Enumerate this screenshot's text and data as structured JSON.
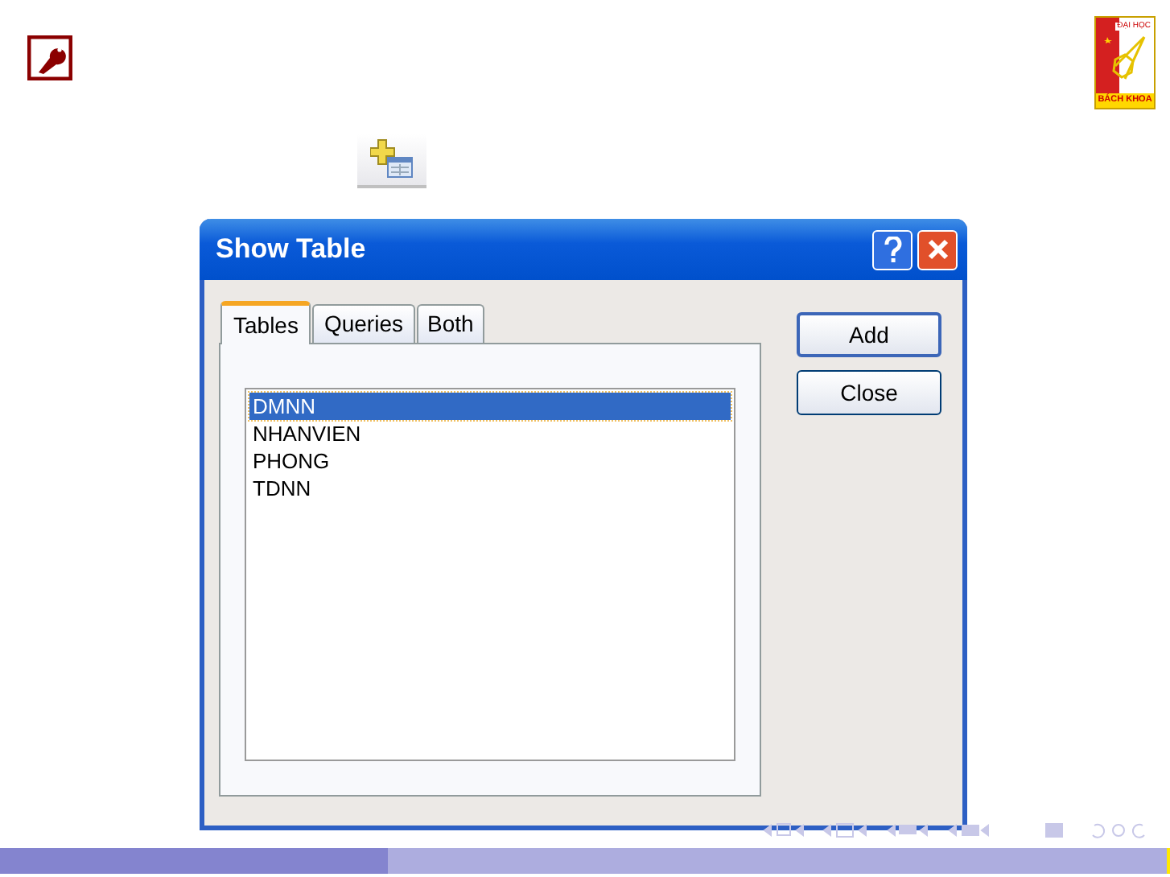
{
  "logo": {
    "top_text": "ĐẠI HỌC",
    "bottom_text": "BÁCH KHOA"
  },
  "dialog": {
    "title": "Show Table",
    "tabs": [
      {
        "label": "Tables",
        "selected": true
      },
      {
        "label": "Queries",
        "selected": false
      },
      {
        "label": "Both",
        "selected": false
      }
    ],
    "items": [
      {
        "label": "DMNN",
        "selected": true
      },
      {
        "label": "NHANVIEN",
        "selected": false
      },
      {
        "label": "PHONG",
        "selected": false
      },
      {
        "label": "TDNN",
        "selected": false
      }
    ],
    "buttons": [
      "Add",
      "Close"
    ]
  }
}
